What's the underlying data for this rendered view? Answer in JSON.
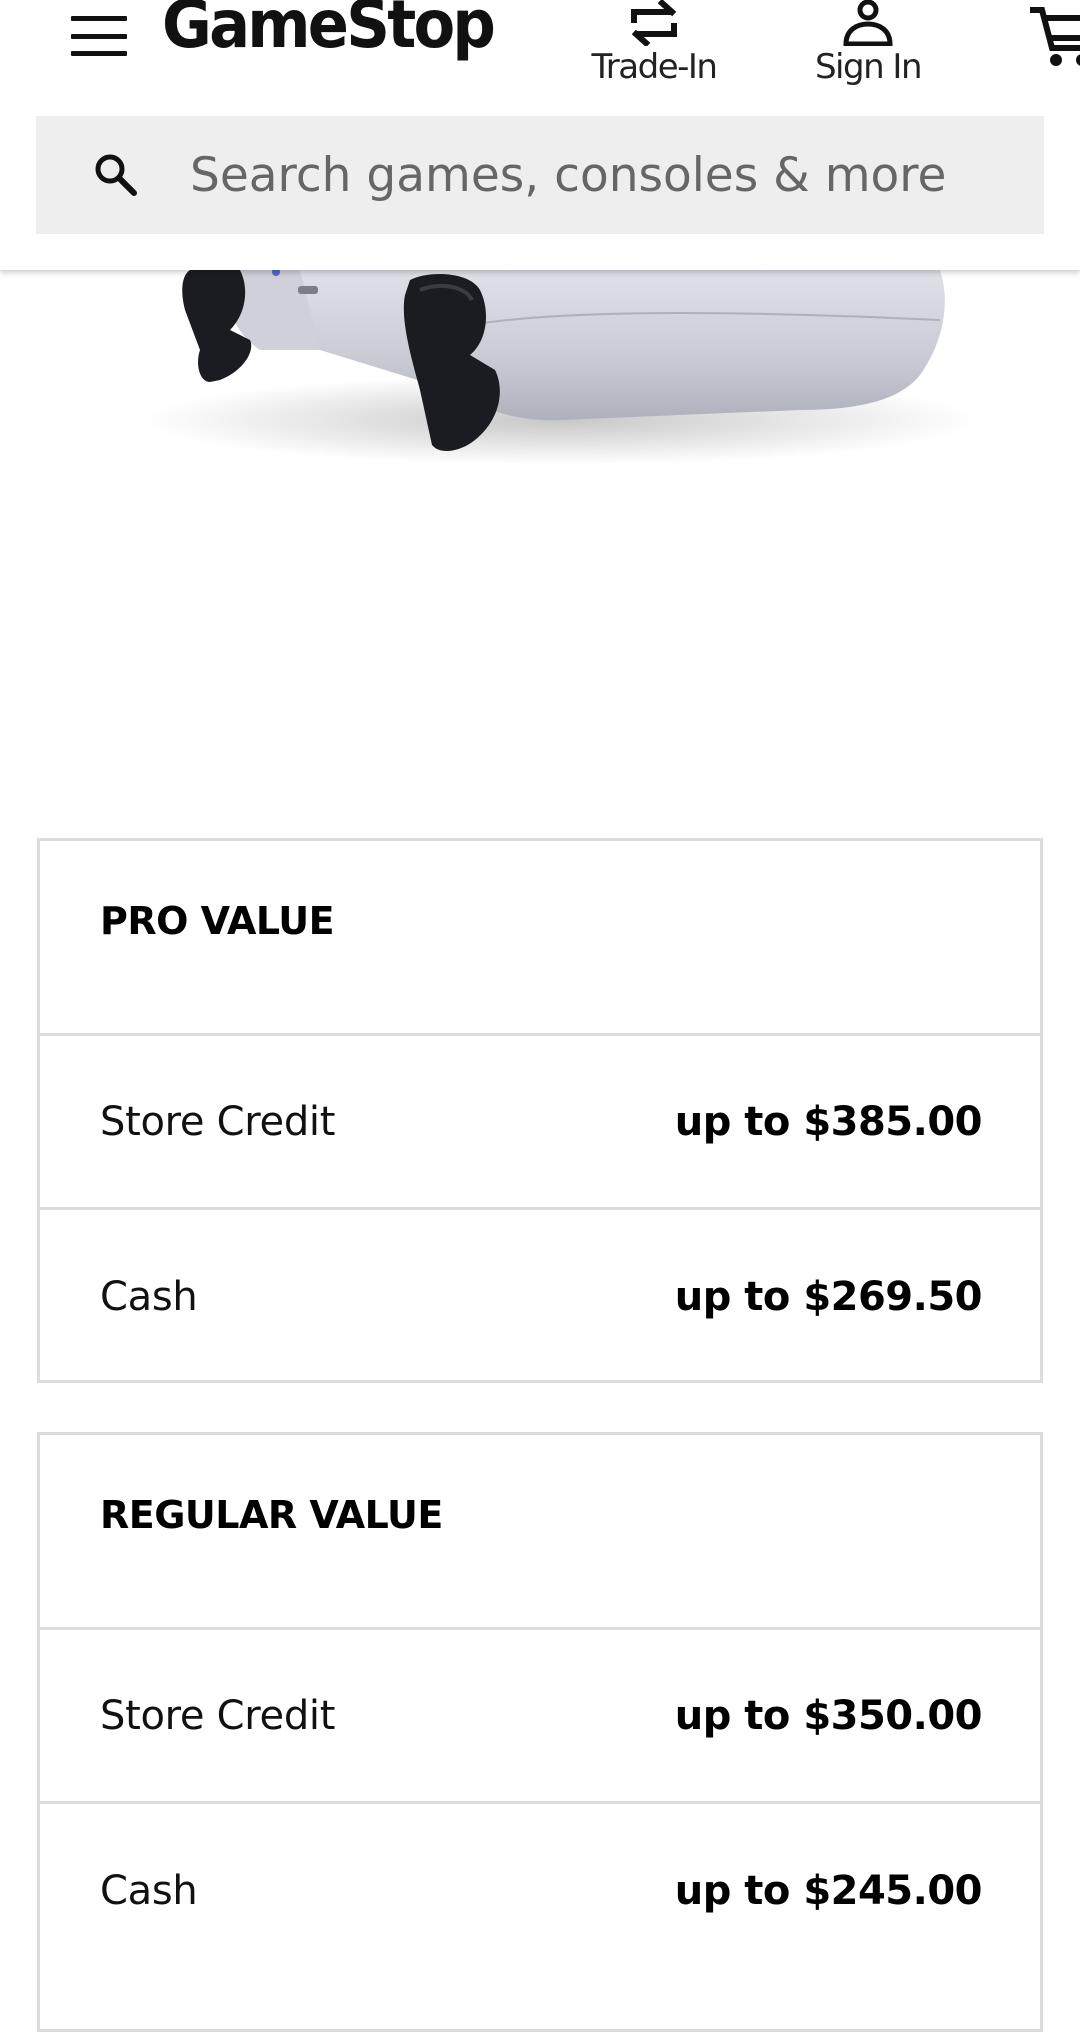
{
  "header": {
    "logo": "GameStop",
    "trade_in_label": "Trade-In",
    "sign_in_label": "Sign In",
    "icons": {
      "menu": "hamburger-menu-icon",
      "trade_in": "swap-arrows-icon",
      "sign_in": "user-icon",
      "cart": "shopping-cart-icon"
    }
  },
  "search": {
    "placeholder": "Search games, consoles & more",
    "value": "",
    "icon": "search-icon"
  },
  "product": {
    "image": "controller-image"
  },
  "pro_value": {
    "title": "PRO VALUE",
    "rows": [
      {
        "label": "Store Credit",
        "amount": "up to $385.00"
      },
      {
        "label": "Cash",
        "amount": "up to $269.50"
      }
    ]
  },
  "regular_value": {
    "title": "REGULAR VALUE",
    "rows": [
      {
        "label": "Store Credit",
        "amount": "up to $350.00"
      },
      {
        "label": "Cash",
        "amount": "up to $245.00"
      }
    ]
  }
}
